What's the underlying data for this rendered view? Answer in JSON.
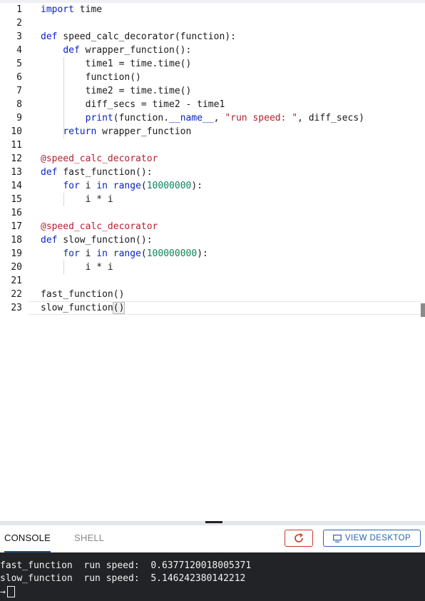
{
  "editor": {
    "lines": [
      {
        "n": "1",
        "html": "<span class=\"kw\">import</span> time"
      },
      {
        "n": "2",
        "html": ""
      },
      {
        "n": "3",
        "html": "<span class=\"kw\">def</span> speed_calc_decorator(function):"
      },
      {
        "n": "4",
        "html": "    <span class=\"kw\">def</span> wrapper_function():"
      },
      {
        "n": "5",
        "html": "        time1 = time.time()"
      },
      {
        "n": "6",
        "html": "        function()"
      },
      {
        "n": "7",
        "html": "        time2 = time.time()"
      },
      {
        "n": "8",
        "html": "        diff_secs = time2 - time1"
      },
      {
        "n": "9",
        "html": "        <span class=\"kw\">print</span>(function.<span class=\"kw\">__name__</span>, <span class=\"str\">\"run speed: \"</span>, diff_secs)"
      },
      {
        "n": "10",
        "html": "    <span class=\"kw\">return</span> wrapper_function"
      },
      {
        "n": "11",
        "html": ""
      },
      {
        "n": "12",
        "html": "<span class=\"dec\">@speed_calc_decorator</span>"
      },
      {
        "n": "13",
        "html": "<span class=\"kw\">def</span> fast_function():"
      },
      {
        "n": "14",
        "html": "    <span class=\"kw\">for</span> i <span class=\"kw\">in</span> <span class=\"kw\">range</span>(<span class=\"num\">10000000</span>):"
      },
      {
        "n": "15",
        "html": "        i * i"
      },
      {
        "n": "16",
        "html": ""
      },
      {
        "n": "17",
        "html": "<span class=\"dec\">@speed_calc_decorator</span>"
      },
      {
        "n": "18",
        "html": "<span class=\"kw\">def</span> slow_function():"
      },
      {
        "n": "19",
        "html": "    <span class=\"kw\">for</span> i <span class=\"kw\">in</span> <span class=\"kw\">range</span>(<span class=\"num\">100000000</span>):"
      },
      {
        "n": "20",
        "html": "        i * i"
      },
      {
        "n": "21",
        "html": ""
      },
      {
        "n": "22",
        "html": "fast_function()"
      },
      {
        "n": "23",
        "html": "slow_function<span class=\"bracket\">()</span>"
      }
    ],
    "current_line": "23"
  },
  "tabs": {
    "console": "CONSOLE",
    "shell": "SHELL"
  },
  "toolbar": {
    "refresh_icon": "refresh-icon",
    "desktop_icon": "monitor-icon",
    "view_desktop_label": "VIEW DESKTOP"
  },
  "console": {
    "lines": [
      "fast_function  run speed:  0.6377120018005371",
      "slow_function  run speed:  5.146242380142212"
    ],
    "prompt": "→"
  },
  "colors": {
    "keyword": "#0b23c7",
    "string": "#b0212f",
    "number": "#098658",
    "console_bg": "#222326",
    "refresh_border": "#c23a2e",
    "desktop_border": "#2d62a8"
  }
}
